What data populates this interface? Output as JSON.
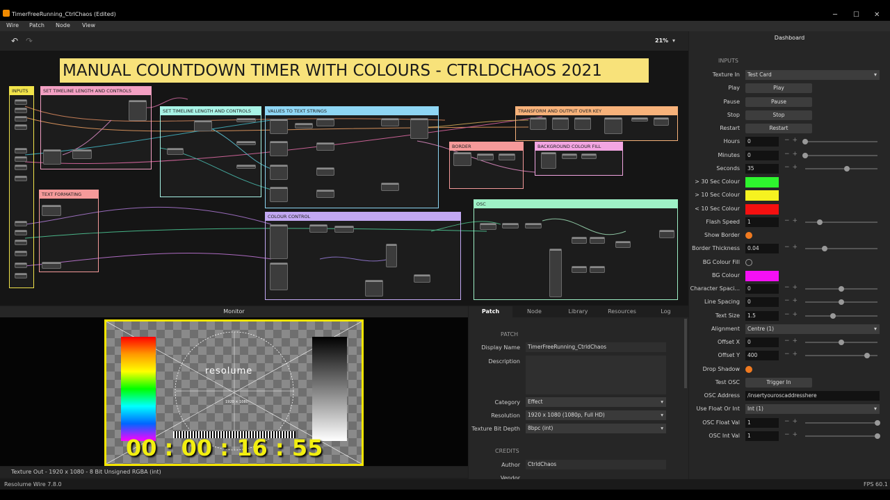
{
  "window": {
    "title": "TimerFreeRunning_CtrlChaos (Edited)",
    "minimize": "─",
    "maximize": "☐",
    "close": "✕"
  },
  "menu": [
    "Wire",
    "Patch",
    "Node",
    "View"
  ],
  "toolbar": {
    "undo": "↶",
    "redo": "↷",
    "zoom": "21%",
    "zoom_chevron": "▾"
  },
  "canvas": {
    "banner": "MANUAL COUNTDOWN TIMER WITH COLOURS - CTRLDCHAOS 2021",
    "groups": [
      {
        "label": "INPUTS",
        "color": "#f2e44a"
      },
      {
        "label": "SET TIMELINE LENGTH AND CONTROLS",
        "color": "#f3a0c3"
      },
      {
        "label": "SET TIMELINE LENGTH AND CONTROLS",
        "color": "#a8f3e6"
      },
      {
        "label": "VALUES TO TEXT STRINGS",
        "color": "#8ed6f4"
      },
      {
        "label": "TRANSFORM AND OUTPUT OVER KEY",
        "color": "#f7b27a"
      },
      {
        "label": "BORDER",
        "color": "#f59a9a"
      },
      {
        "label": "BACKGROUND COLOUR FILL",
        "color": "#f3a5e2"
      },
      {
        "label": "TEXT FORMATING",
        "color": "#f59a9a"
      },
      {
        "label": "COLOUR CONTROL",
        "color": "#c2a8f3"
      },
      {
        "label": "OSC",
        "color": "#9ef0c6"
      }
    ]
  },
  "dashboard": {
    "title": "Dashboard",
    "section": "INPUTS",
    "rows": [
      {
        "label": "Texture In",
        "kind": "select",
        "value": "Test Card"
      },
      {
        "label": "Play",
        "kind": "button",
        "value": "Play"
      },
      {
        "label": "Pause",
        "kind": "button",
        "value": "Pause"
      },
      {
        "label": "Stop",
        "kind": "button",
        "value": "Stop"
      },
      {
        "label": "Restart",
        "kind": "button",
        "value": "Restart"
      },
      {
        "label": "Hours",
        "kind": "number",
        "value": "0",
        "level": 0
      },
      {
        "label": "Minutes",
        "kind": "number",
        "value": "0",
        "level": 0
      },
      {
        "label": "Seconds",
        "kind": "number",
        "value": "35",
        "level": 0.58
      },
      {
        "label": "> 30 Sec Colour",
        "kind": "color",
        "value": "#2ef52e"
      },
      {
        "label": "> 10 Sec Colour",
        "kind": "color",
        "value": "#f6f220"
      },
      {
        "label": "< 10 Sec Colour",
        "kind": "color",
        "value": "#f51010"
      },
      {
        "label": "Flash Speed",
        "kind": "number",
        "value": "1",
        "level": 0.2
      },
      {
        "label": "Show Border",
        "kind": "check",
        "value": true
      },
      {
        "label": "Border Thickness",
        "kind": "number",
        "value": "0.04",
        "level": 0.27
      },
      {
        "label": "BG Colour Fill",
        "kind": "check",
        "value": false
      },
      {
        "label": "BG Colour",
        "kind": "color",
        "value": "#f510f5"
      },
      {
        "label": "Character Spaci...",
        "kind": "number",
        "value": "0",
        "level": 0.5
      },
      {
        "label": "Line Spacing",
        "kind": "number",
        "value": "0",
        "level": 0.5
      },
      {
        "label": "Text Size",
        "kind": "number",
        "value": "1.5",
        "level": 0.38
      },
      {
        "label": "Alignment",
        "kind": "select",
        "value": "Centre (1)"
      },
      {
        "label": "Offset X",
        "kind": "number",
        "value": "0",
        "level": 0.5
      },
      {
        "label": "Offset Y",
        "kind": "number",
        "value": "400",
        "level": 0.86
      },
      {
        "label": "Drop Shadow",
        "kind": "check",
        "value": true
      },
      {
        "label": "Test OSC",
        "kind": "button",
        "value": "Trigger In"
      },
      {
        "label": "OSC Address",
        "kind": "text",
        "value": "/insertyouroscaddresshere"
      },
      {
        "label": "Use Float Or Int",
        "kind": "select",
        "value": "Int (1)"
      },
      {
        "label": "OSC Float Val",
        "kind": "number",
        "value": "1",
        "level": 1
      },
      {
        "label": "OSC Int Val",
        "kind": "number",
        "value": "1",
        "level": 1
      }
    ]
  },
  "monitor": {
    "title": "Monitor",
    "timer_text": "00 : 00 : 16 : 55",
    "card_logo": "resolume",
    "card_res": "1920 × 1080",
    "status": "Texture Out - 1920 x 1080 - 8 Bit Unsigned RGBA (int)"
  },
  "patch_panel": {
    "tabs": [
      "Patch",
      "Node",
      "Library",
      "Resources",
      "Log"
    ],
    "section": "PATCH",
    "display_name_label": "Display Name",
    "display_name": "TimerFreeRunning_CtrldChaos",
    "description_label": "Description",
    "description": "",
    "category_label": "Category",
    "category": "Effect",
    "resolution_label": "Resolution",
    "resolution": "1920 x 1080 (1080p, Full HD)",
    "bitdepth_label": "Texture Bit Depth",
    "bitdepth": "8bpc (int)",
    "credits_section": "CREDITS",
    "author_label": "Author",
    "author": "CtrldChaos",
    "vendor_label": "Vendor"
  },
  "statusbar": {
    "left": "Resolume Wire 7.8.0",
    "right": "FPS 60.1"
  }
}
